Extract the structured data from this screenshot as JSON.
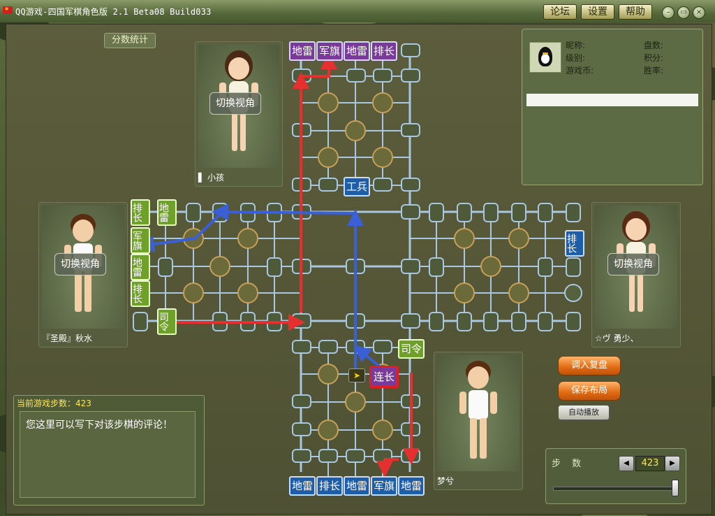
{
  "app": {
    "title": "QQ游戏-四国军棋角色版 2.1 Beta08 Build033",
    "toolbar": {
      "forum": "论坛",
      "settings": "设置",
      "help": "帮助"
    },
    "window_controls": {
      "minimize": "–",
      "restore": "▭",
      "close": "×"
    }
  },
  "stats_tab": "分数统计",
  "info": {
    "nickname_label": "昵称:",
    "games_label": "盘数:",
    "level_label": "级别:",
    "score_label": "积分:",
    "coins_label": "游戏币:",
    "winrate_label": "胜率:"
  },
  "players": {
    "north": {
      "name": "▌ 小孩",
      "switch": "切换视角"
    },
    "west": {
      "name": "『圣殿』秋水",
      "switch": "切换视角"
    },
    "east": {
      "name": "☆ヴ 勇少、",
      "switch": "切换视角"
    },
    "south": {
      "name": "梦兮"
    }
  },
  "steps": {
    "header": "当前游戏步数：423",
    "comment": "您这里可以写下对该步棋的评论！",
    "label": "步 数",
    "value": "423"
  },
  "buttons": {
    "load_replay": "调入复盘",
    "save_layout": "保存布局",
    "autoplay": "自动播放",
    "prev": "◀",
    "next": "▶"
  },
  "pieces": {
    "north_row": [
      "地雷",
      "军旗",
      "地雷",
      "排长"
    ],
    "north_engineer": "工兵",
    "west_col": [
      "排长",
      "军旗",
      "地雷",
      "排长"
    ],
    "west_bomb": "地雷",
    "west_mid": "司令",
    "east_one": "排长",
    "south_row": [
      "地雷",
      "排长",
      "地雷",
      "军旗",
      "地雷"
    ],
    "south_commander": "司令",
    "south_captain": "连长"
  },
  "colors": {
    "purple": "#7a3a9a",
    "blue": "#1e5da8",
    "green": "#6ea02a",
    "red_arrow": "#e63030",
    "blue_arrow": "#3a5fd6"
  }
}
